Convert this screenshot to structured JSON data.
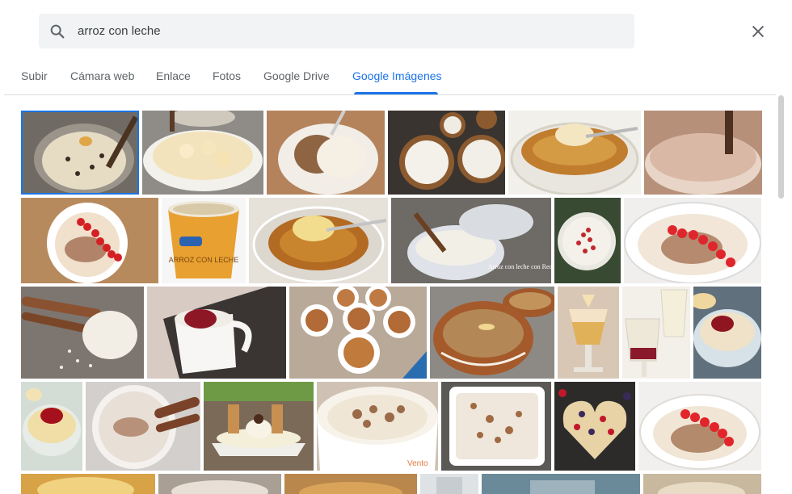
{
  "search": {
    "query": "arroz con leche",
    "search_icon": "search-icon"
  },
  "close_icon": "close-icon",
  "tabs": [
    {
      "label": "Subir"
    },
    {
      "label": "Cámara web"
    },
    {
      "label": "Enlace"
    },
    {
      "label": "Fotos"
    },
    {
      "label": "Google Drive"
    },
    {
      "label": "Google Imágenes",
      "active": true
    }
  ],
  "colors": {
    "accent": "#1a73e8",
    "search_bg": "#f1f3f4",
    "tab_text": "#5f6368"
  },
  "image_watermark": "Arroz con leche con Receta Brasileja",
  "image_brand_text": "ARROZ CON LECHE",
  "image_bottom_text": "Vento"
}
